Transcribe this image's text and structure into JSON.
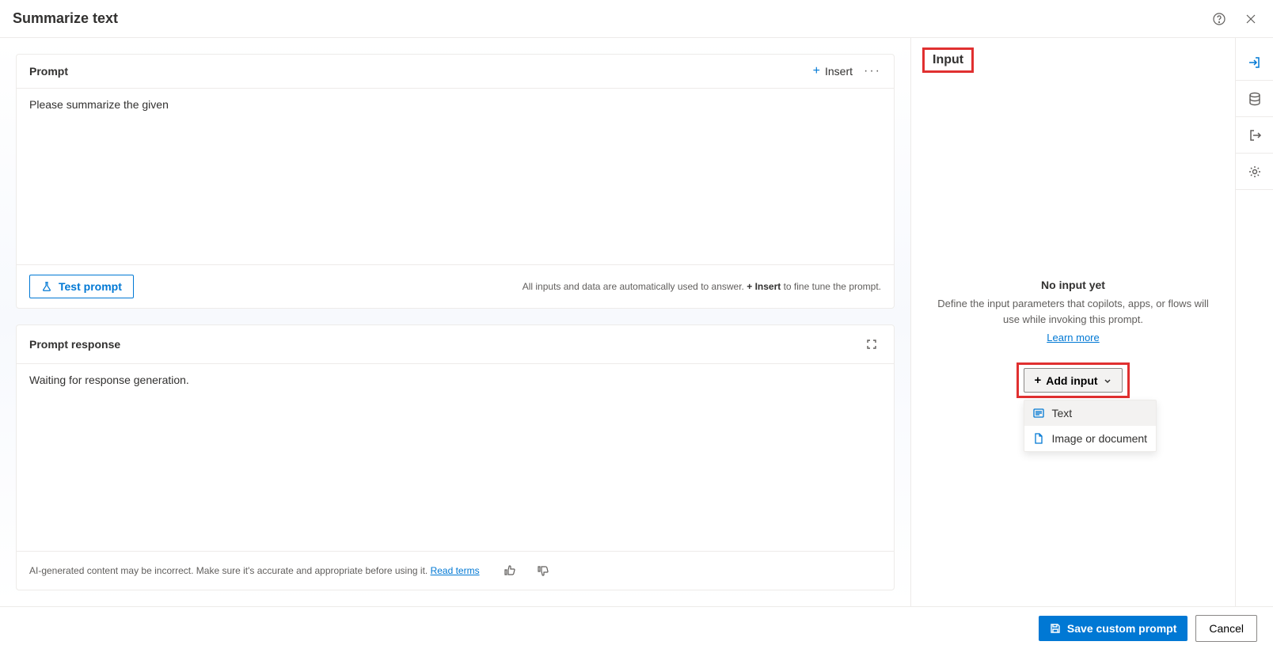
{
  "header": {
    "title": "Summarize text"
  },
  "prompt": {
    "header_label": "Prompt",
    "insert_label": "Insert",
    "text": "Please summarize the given",
    "test_label": "Test prompt",
    "hint_pre": "All inputs and data are automatically used to answer. ",
    "hint_bold_prefix": "+ ",
    "hint_bold": "Insert",
    "hint_post": " to fine tune the prompt."
  },
  "response": {
    "header_label": "Prompt response",
    "waiting": "Waiting for response generation.",
    "disclaimer": "AI-generated content may be incorrect. Make sure it's accurate and appropriate before using it. ",
    "read_terms": "Read terms"
  },
  "input_panel": {
    "tab_label": "Input",
    "empty_title": "No input yet",
    "empty_desc": "Define the input parameters that copilots, apps, or flows will use while invoking this prompt.",
    "learn_more": "Learn more",
    "add_label": "Add input",
    "options": {
      "text": "Text",
      "image_doc": "Image or document"
    }
  },
  "footer": {
    "save": "Save custom prompt",
    "cancel": "Cancel"
  }
}
